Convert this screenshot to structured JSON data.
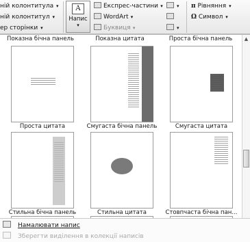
{
  "ribbon": {
    "left": {
      "header_label": "ній колонтитула",
      "footer_label": "ній колонтитул",
      "page_number_label": "ер сторінки"
    },
    "text_box": {
      "label": "Напис",
      "icon_glyph": "A"
    },
    "insert_group": {
      "quick_parts": "Експрес-частини",
      "wordart": "WordArt",
      "dropcap": "Буквиця"
    },
    "symbols": {
      "equation_symbol": "π",
      "equation_label": "Рівняння",
      "symbol_symbol": "Ω",
      "symbol_label": "Символ"
    }
  },
  "gallery": {
    "top_row_captions": [
      "Показна бічна панель",
      "Показна цитата",
      "Проста бічна панель"
    ],
    "rows": [
      [
        "Проста цитата",
        "Смугаста бічна панель",
        "Смугаста цитата"
      ],
      [
        "Стильна бічна панель",
        "Стильна цитата",
        "Стовпчаста бічна пан..."
      ]
    ]
  },
  "footer": {
    "draw_text_box": "Намалювати напис",
    "save_selection": "Зберегти виділення в колекції написів"
  }
}
